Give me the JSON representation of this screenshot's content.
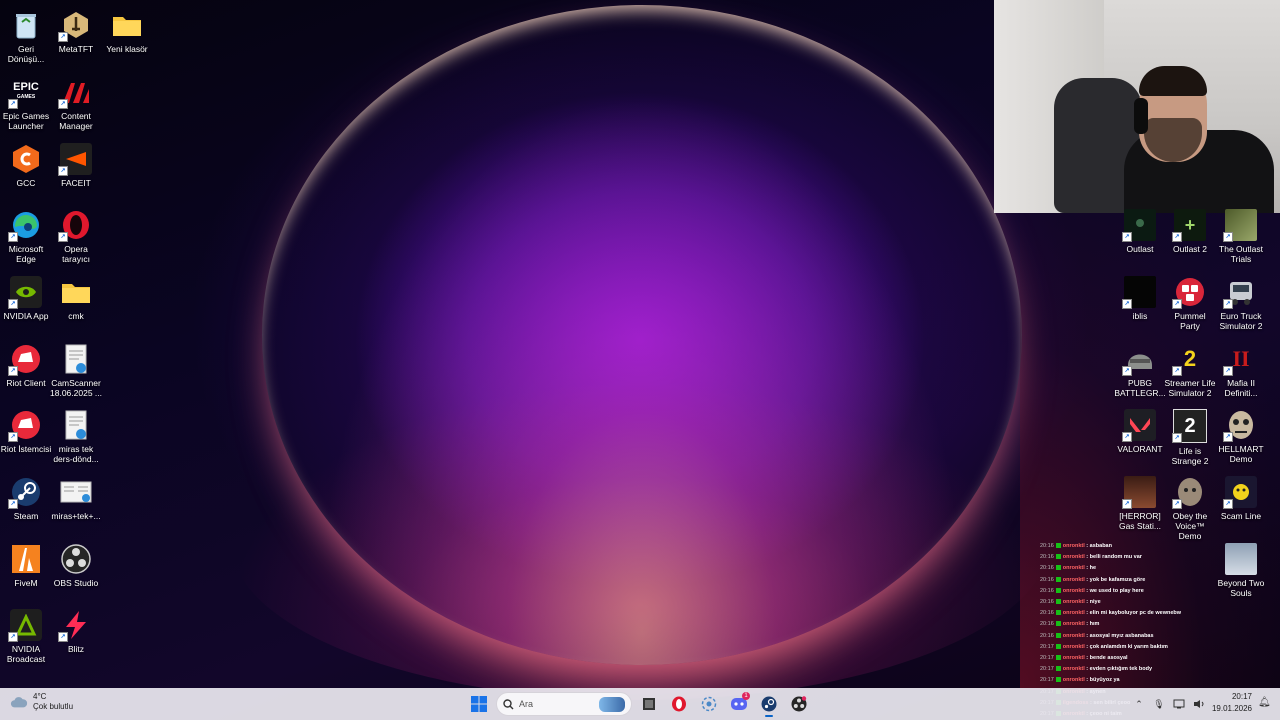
{
  "desktop": {
    "left_icons": [
      {
        "label": "Geri Dönüşü...",
        "icon": "recycle-bin-icon"
      },
      {
        "label": "MetaTFT",
        "icon": "metatft-icon"
      },
      {
        "label": "Yeni klasör",
        "icon": "folder-icon"
      },
      {
        "label": "Epic Games Launcher",
        "icon": "epic-games-icon"
      },
      {
        "label": "Content Manager",
        "icon": "content-manager-icon"
      },
      {
        "label": "GCC",
        "icon": "gcc-icon"
      },
      {
        "label": "FACEIT",
        "icon": "faceit-icon"
      },
      {
        "label": "Microsoft Edge",
        "icon": "edge-icon"
      },
      {
        "label": "Opera tarayıcı",
        "icon": "opera-icon"
      },
      {
        "label": "NVIDIA App",
        "icon": "nvidia-icon"
      },
      {
        "label": "cmk",
        "icon": "folder-icon"
      },
      {
        "label": "Riot Client",
        "icon": "riot-icon"
      },
      {
        "label": "CamScanner 18.06.2025 ...",
        "icon": "document-icon"
      },
      {
        "label": "Riot İstemcisi",
        "icon": "riot-icon"
      },
      {
        "label": "miras tek ders-dönd...",
        "icon": "document-icon"
      },
      {
        "label": "Steam",
        "icon": "steam-icon"
      },
      {
        "label": "miras+tek+...",
        "icon": "document-icon"
      },
      {
        "label": "FiveM",
        "icon": "fivem-icon"
      },
      {
        "label": "OBS Studio",
        "icon": "obs-icon"
      },
      {
        "label": "NVIDIA Broadcast",
        "icon": "nvidia-broadcast-icon"
      },
      {
        "label": "Blitz",
        "icon": "blitz-icon"
      }
    ],
    "right_icons": [
      {
        "label": "Outlast",
        "icon": "outlast-icon"
      },
      {
        "label": "Outlast 2",
        "icon": "outlast2-icon"
      },
      {
        "label": "The Outlast Trials",
        "icon": "outlast-trials-icon"
      },
      {
        "label": "iblis",
        "icon": "iblis-icon"
      },
      {
        "label": "Pummel Party",
        "icon": "pummel-party-icon"
      },
      {
        "label": "Euro Truck Simulator 2",
        "icon": "euro-truck-icon"
      },
      {
        "label": "PUBG BATTLEGR...",
        "icon": "pubg-icon"
      },
      {
        "label": "Streamer Life Simulator 2",
        "icon": "streamer-life-icon"
      },
      {
        "label": "Mafia II Definiti...",
        "icon": "mafia-icon"
      },
      {
        "label": "VALORANT",
        "icon": "valorant-icon"
      },
      {
        "label": "Life is Strange 2",
        "icon": "life-is-strange-icon"
      },
      {
        "label": "HELLMART Demo",
        "icon": "hellmart-icon"
      },
      {
        "label": "[HERROR] Gas Stati...",
        "icon": "herror-icon"
      },
      {
        "label": "Obey the Voice™ Demo",
        "icon": "obey-voice-icon"
      },
      {
        "label": "Scam Line",
        "icon": "scam-line-icon"
      },
      {
        "label": "Beyond Two Souls",
        "icon": "beyond-two-souls-icon"
      }
    ]
  },
  "chat": {
    "messages": [
      {
        "time": "20:16",
        "user": "onronktl",
        "text": "asbaban"
      },
      {
        "time": "20:16",
        "user": "onronktl",
        "text": "belli random mu var"
      },
      {
        "time": "20:16",
        "user": "onronktl",
        "text": "he"
      },
      {
        "time": "20:16",
        "user": "onronktl",
        "text": "yok be kafamıza göre"
      },
      {
        "time": "20:16",
        "user": "onronktl",
        "text": "we used to play here"
      },
      {
        "time": "20:16",
        "user": "onronktl",
        "text": "niye"
      },
      {
        "time": "20:16",
        "user": "onronktl",
        "text": "elin mi kayboluyor pc de wewnebw"
      },
      {
        "time": "20:16",
        "user": "onronktl",
        "text": "hım"
      },
      {
        "time": "20:16",
        "user": "onronktl",
        "text": "asosyal myız asbanabas"
      },
      {
        "time": "20:17",
        "user": "onronktl",
        "text": "çok anlamdım ki yarım baktım"
      },
      {
        "time": "20:17",
        "user": "onronktl",
        "text": "bende asosyal"
      },
      {
        "time": "20:17",
        "user": "onronktl",
        "text": "evden çıktığım tek body"
      },
      {
        "time": "20:17",
        "user": "onronktl",
        "text": "büyüyoz ya"
      },
      {
        "time": "20:17",
        "user": "onronktl",
        "text": "aynen"
      },
      {
        "time": "20:17",
        "user": "ilgendoss",
        "text": "sen bilirl çeoo"
      },
      {
        "time": "20:17",
        "user": "onronktl",
        "text": "çeoo ni taim"
      }
    ]
  },
  "taskbar": {
    "weather_temp": "4°C",
    "weather_desc": "Çok bulutlu",
    "search_placeholder": "Ara",
    "apps": [
      {
        "name": "file-explorer",
        "icon": "file-explorer-icon"
      },
      {
        "name": "opera",
        "icon": "opera-icon"
      },
      {
        "name": "network",
        "icon": "network-app-icon"
      },
      {
        "name": "discord",
        "icon": "discord-icon",
        "badge": "1"
      },
      {
        "name": "steam",
        "icon": "steam-icon",
        "active": true
      },
      {
        "name": "obs",
        "icon": "obs-icon"
      }
    ],
    "time": "20:17",
    "date": "19.01.2026"
  },
  "colors": {
    "chat_user": "#ff6464",
    "chat_badge": "#17c017",
    "accent": "#0a64c8"
  }
}
